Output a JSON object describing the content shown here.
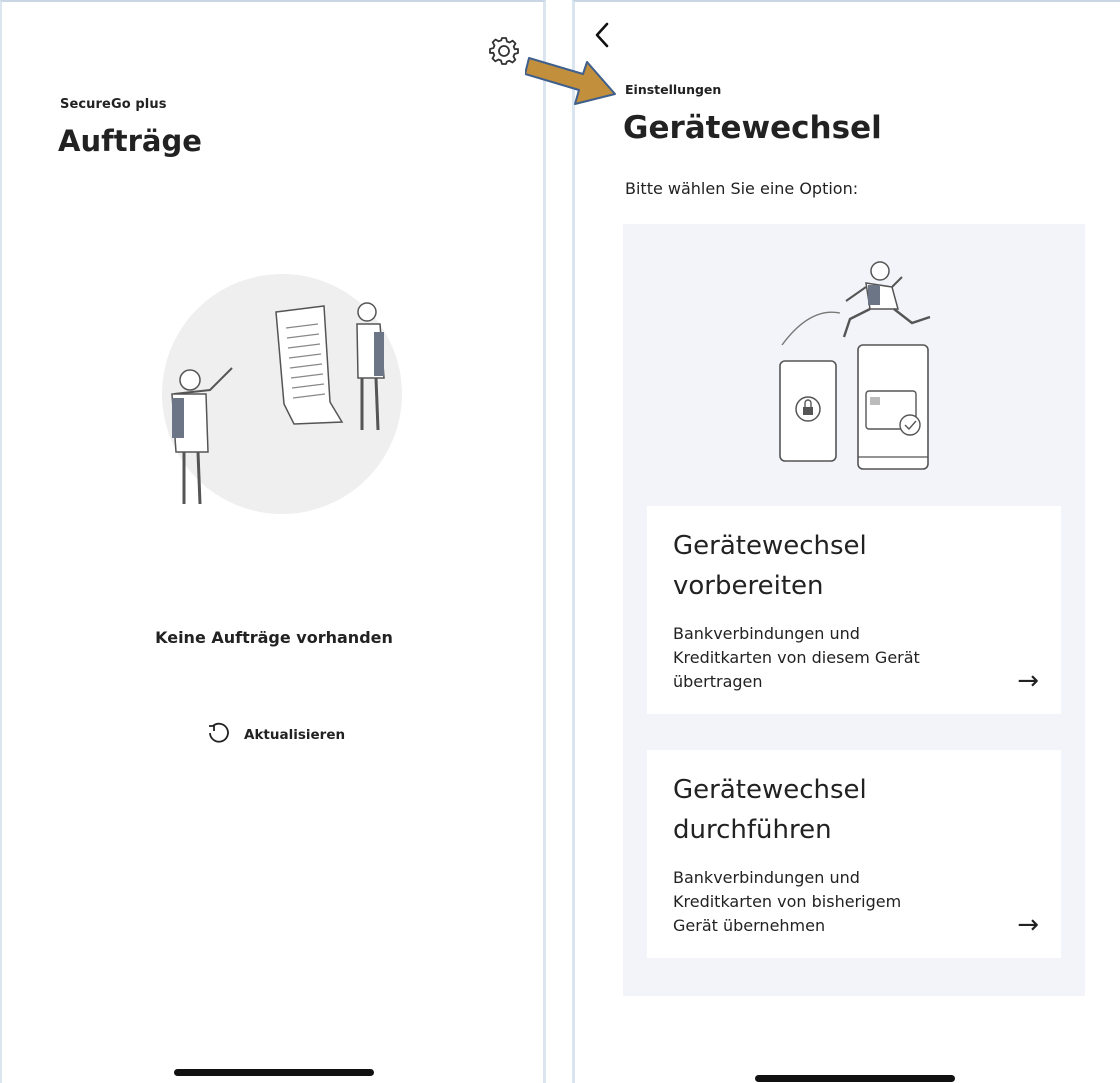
{
  "left": {
    "app_subtitle": "SecureGo plus",
    "title": "Aufträge",
    "empty_message": "Keine Aufträge vorhanden",
    "refresh_label": "Aktualisieren",
    "icons": {
      "settings": "gear-icon",
      "refresh": "refresh-icon"
    }
  },
  "right": {
    "breadcrumb": "Einstellungen",
    "title": "Gerätewechsel",
    "prompt": "Bitte wählen Sie eine Option:",
    "options": [
      {
        "title": "Gerätewechsel\nvorbereiten",
        "description": "Bankverbindungen und\nKreditkarten von diesem Gerät\nübertragen",
        "arrow": "→"
      },
      {
        "title": "Gerätewechsel\ndurchführen",
        "description": "Bankverbindungen und\nKreditkarten von bisherigem\nGerät übernehmen",
        "arrow": "→"
      }
    ],
    "icons": {
      "back": "chevron-left-icon",
      "option_arrow": "arrow-right-icon"
    }
  },
  "colors": {
    "annotation_arrow": "#c28f3d",
    "panel_background": "#f3f4f9",
    "text": "#222222"
  }
}
